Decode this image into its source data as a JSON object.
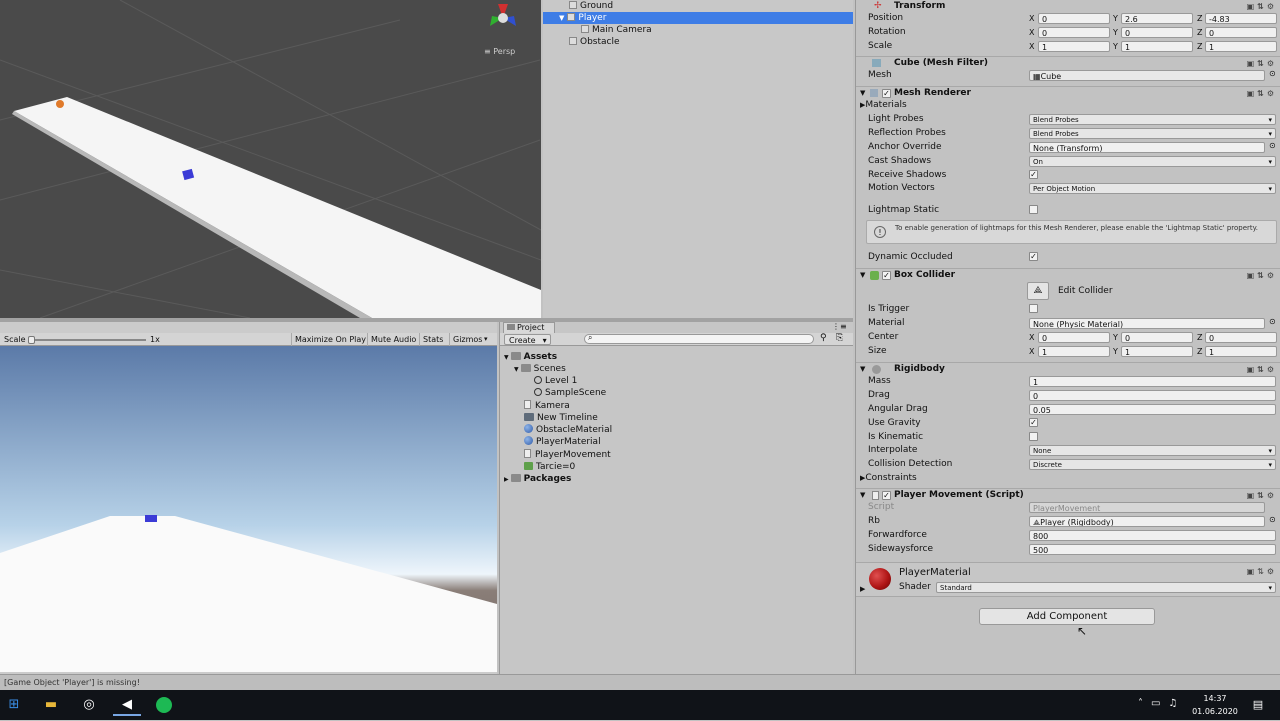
{
  "colors": {
    "selection": "#3e7de6",
    "taskbar": "#101318",
    "spotify": "#1db954",
    "material_red": "#b01616",
    "player_cube": "#3b3bd6"
  },
  "scene": {
    "persp_label": "≡ Persp"
  },
  "hierarchy": {
    "items": [
      {
        "label": "Ground",
        "selected": false
      },
      {
        "label": "Player",
        "selected": true
      },
      {
        "label": "Main Camera",
        "selected": false
      },
      {
        "label": "Obstacle",
        "selected": false
      }
    ]
  },
  "game": {
    "scale_label": "Scale",
    "scale_value": "1x",
    "maximize_on_play": "Maximize On Play",
    "mute_audio": "Mute Audio",
    "stats": "Stats",
    "gizmos": "Gizmos"
  },
  "project": {
    "tab": "Project",
    "create": "Create",
    "tree": [
      {
        "label": "Assets",
        "icon": "folder-icon",
        "bold": true
      },
      {
        "label": "Scenes",
        "icon": "folder-icon",
        "bold": false
      },
      {
        "label": "Level 1",
        "icon": "unity-scene-icon",
        "bold": false
      },
      {
        "label": "SampleScene",
        "icon": "unity-scene-icon",
        "bold": false
      },
      {
        "label": "Kamera",
        "icon": "script-icon",
        "bold": false
      },
      {
        "label": "New Timeline",
        "icon": "timeline-icon",
        "bold": false
      },
      {
        "label": "ObstacleMaterial",
        "icon": "material-icon",
        "bold": false
      },
      {
        "label": "PlayerMaterial",
        "icon": "material-icon",
        "bold": false
      },
      {
        "label": "PlayerMovement",
        "icon": "script-icon",
        "bold": false
      },
      {
        "label": "Tarcie=0",
        "icon": "physic-material-icon",
        "bold": false
      },
      {
        "label": "Packages",
        "icon": "folder-icon",
        "bold": true
      }
    ]
  },
  "inspector": {
    "transform": {
      "title": "Transform",
      "position": {
        "label": "Position",
        "x": "0",
        "y": "2.6",
        "z": "-4.83"
      },
      "rotation": {
        "label": "Rotation",
        "x": "0",
        "y": "0",
        "z": "0"
      },
      "scale": {
        "label": "Scale",
        "x": "1",
        "y": "1",
        "z": "1"
      }
    },
    "mesh_filter": {
      "title": "Cube (Mesh Filter)",
      "mesh_label": "Mesh",
      "mesh_value": "Cube"
    },
    "mesh_renderer": {
      "title": "Mesh Renderer",
      "materials": "Materials",
      "light_probes": {
        "label": "Light Probes",
        "value": "Blend Probes"
      },
      "reflection_probes": {
        "label": "Reflection Probes",
        "value": "Blend Probes"
      },
      "anchor_override": {
        "label": "Anchor Override",
        "value": "None (Transform)"
      },
      "cast_shadows": {
        "label": "Cast Shadows",
        "value": "On"
      },
      "receive_shadows": {
        "label": "Receive Shadows"
      },
      "motion_vectors": {
        "label": "Motion Vectors",
        "value": "Per Object Motion"
      },
      "lightmap_static": {
        "label": "Lightmap Static"
      },
      "info": "To enable generation of lightmaps for this Mesh Renderer, please enable the 'Lightmap Static' property.",
      "dynamic_occluded": {
        "label": "Dynamic Occluded"
      }
    },
    "box_collider": {
      "title": "Box Collider",
      "edit_collider": "Edit Collider",
      "is_trigger": "Is Trigger",
      "material": {
        "label": "Material",
        "value": "None (Physic Material)"
      },
      "center": {
        "label": "Center",
        "x": "0",
        "y": "0",
        "z": "0"
      },
      "size": {
        "label": "Size",
        "x": "1",
        "y": "1",
        "z": "1"
      }
    },
    "rigidbody": {
      "title": "Rigidbody",
      "mass": {
        "label": "Mass",
        "value": "1"
      },
      "drag": {
        "label": "Drag",
        "value": "0"
      },
      "angular_drag": {
        "label": "Angular Drag",
        "value": "0.05"
      },
      "use_gravity": "Use Gravity",
      "is_kinematic": "Is Kinematic",
      "interpolate": {
        "label": "Interpolate",
        "value": "None"
      },
      "collision_detection": {
        "label": "Collision Detection",
        "value": "Discrete"
      },
      "constraints": "Constraints"
    },
    "player_movement": {
      "title": "Player Movement (Script)",
      "script": {
        "label": "Script",
        "value": "PlayerMovement"
      },
      "rb": {
        "label": "Rb",
        "value": "Player (Rigidbody)"
      },
      "forwardforce": {
        "label": "Forwardforce",
        "value": "800"
      },
      "sidewaysforce": {
        "label": "Sidewaysforce",
        "value": "500"
      }
    },
    "material": {
      "name": "PlayerMaterial",
      "shader_label": "Shader",
      "shader_value": "Standard"
    },
    "add_component": "Add Component"
  },
  "status": {
    "message": "[Game Object 'Player'] is missing!"
  },
  "taskbar": {
    "time": "14:37",
    "date": "01.06.2020"
  }
}
